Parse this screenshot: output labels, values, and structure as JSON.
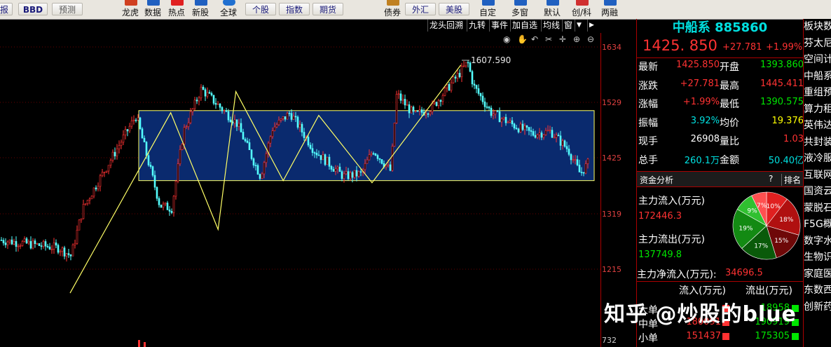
{
  "toolbar": {
    "left_items": [
      "报",
      "BBD",
      "预测"
    ],
    "icons": [
      {
        "label": "龙虎",
        "icon": "dragon-tiger-icon",
        "color": "#d04020"
      },
      {
        "label": "数据",
        "icon": "data-icon",
        "color": "#2060c0"
      },
      {
        "label": "热点",
        "icon": "hot-icon",
        "color": "#e02020"
      },
      {
        "label": "新股",
        "icon": "new-stock-icon",
        "color": "#2060c0"
      },
      {
        "label": "全球",
        "icon": "globe-icon",
        "color": "#2070d0"
      }
    ],
    "tabs": [
      "个股",
      "指数",
      "期货"
    ],
    "right_icons": [
      {
        "label": "债券",
        "icon": "bond-icon",
        "color": "#c08020"
      },
      {
        "label": "自定",
        "icon": "custom-icon",
        "color": "#2060c0"
      },
      {
        "label": "多窗",
        "icon": "multi-window-icon",
        "color": "#2060c0"
      },
      {
        "label": "默认",
        "icon": "default-icon",
        "color": "#2060c0"
      },
      {
        "label": "创/科",
        "icon": "star-market-icon",
        "color": "#d03030"
      },
      {
        "label": "两融",
        "icon": "margin-icon",
        "color": "#2060c0"
      }
    ],
    "right_tabs": [
      "外汇",
      "美股"
    ]
  },
  "chart_controls": [
    "龙头回溯",
    "九转",
    "事件",
    "加自选",
    "均线",
    "窗"
  ],
  "chart_tools": [
    "eye-icon",
    "hand-icon",
    "undo-icon",
    "scissors-icon",
    "crosshair-icon",
    "zoom-in-icon",
    "zoom-out-icon"
  ],
  "chart_data": {
    "type": "candlestick",
    "y_axis_ticks": [
      "1634",
      "1529",
      "1425",
      "1319",
      "1215"
    ],
    "volume_label": "732",
    "peak_label": "1607.590",
    "range_box": {
      "high": 1514,
      "low": 1382
    },
    "colors": {
      "up": "#ff3232",
      "down": "#54ffff",
      "box": "#ffff66",
      "box_fill": "#0a2a6e"
    },
    "trend_points": [
      [
        1170,
        0.0
      ],
      [
        1510,
        0.17
      ],
      [
        1290,
        0.25
      ],
      [
        1550,
        0.28
      ],
      [
        1382,
        0.36
      ],
      [
        1505,
        0.42
      ],
      [
        1378,
        0.51
      ],
      [
        1600,
        0.66
      ]
    ]
  },
  "quote": {
    "name": "中船系",
    "code": "885860",
    "price": "1425. 850",
    "change": "+27.781",
    "change_pct": "+1.99%",
    "rows": [
      {
        "l1": "最新",
        "v1": "1425.850",
        "c1": "red",
        "l2": "开盘",
        "v2": "1393.860",
        "c2": "green"
      },
      {
        "l1": "涨跌",
        "v1": "+27.781",
        "c1": "red",
        "l2": "最高",
        "v2": "1445.411",
        "c2": "red"
      },
      {
        "l1": "涨幅",
        "v1": "+1.99%",
        "c1": "red",
        "l2": "最低",
        "v2": "1390.575",
        "c2": "green"
      },
      {
        "l1": "振幅",
        "v1": "3.92%",
        "c1": "cyan",
        "l2": "均价",
        "v2": "19.376",
        "c2": "yellow"
      },
      {
        "l1": "现手",
        "v1": "26908",
        "c1": "white",
        "l2": "量比",
        "v2": "1.03",
        "c2": "red"
      },
      {
        "l1": "总手",
        "v1": "260.1万",
        "c1": "cyan",
        "l2": "金额",
        "v2": "50.40亿",
        "c2": "cyan"
      }
    ]
  },
  "fund": {
    "title": "资金分析",
    "help": "?",
    "rank": "排名",
    "inflow_label": "主力流入(万元)",
    "inflow": "172446.3",
    "outflow_label": "主力流出(万元)",
    "outflow": "137749.8",
    "net_label": "主力净流入(万元):",
    "net": "34696.5",
    "pie": [
      {
        "pct": 10,
        "label": "10%",
        "color": "#e02020"
      },
      {
        "pct": 18,
        "label": "18%",
        "color": "#b01010"
      },
      {
        "pct": 15,
        "label": "15%",
        "color": "#6e0808"
      },
      {
        "pct": 17,
        "label": "17%",
        "color": "#0a5a0a"
      },
      {
        "pct": 19,
        "label": "19%",
        "color": "#138a13"
      },
      {
        "pct": 9,
        "label": "9%",
        "color": "#30c030"
      },
      {
        "pct": 7,
        "label": "7%",
        "color": "#ff5050"
      }
    ],
    "table_headers": [
      "流入(万元)",
      "流出(万元)"
    ],
    "rows": [
      {
        "label": "大单",
        "in": "",
        "out": "18958"
      },
      {
        "label": "中单",
        "in": "180091",
        "out": "190919"
      },
      {
        "label": "小单",
        "in": "151437",
        "out": "175305"
      }
    ]
  },
  "sidebar": [
    "板块数",
    "芬太尼",
    "空间计",
    "中船系",
    "重组预",
    "算力租",
    "英伟达",
    "共封装",
    "液冷服",
    "互联网",
    "国资云",
    "蒙脱石",
    "F5G概",
    "数字水",
    "生物识",
    "家庭医",
    "东数西",
    "创新药"
  ],
  "watermark": "知乎 @炒股的blue"
}
